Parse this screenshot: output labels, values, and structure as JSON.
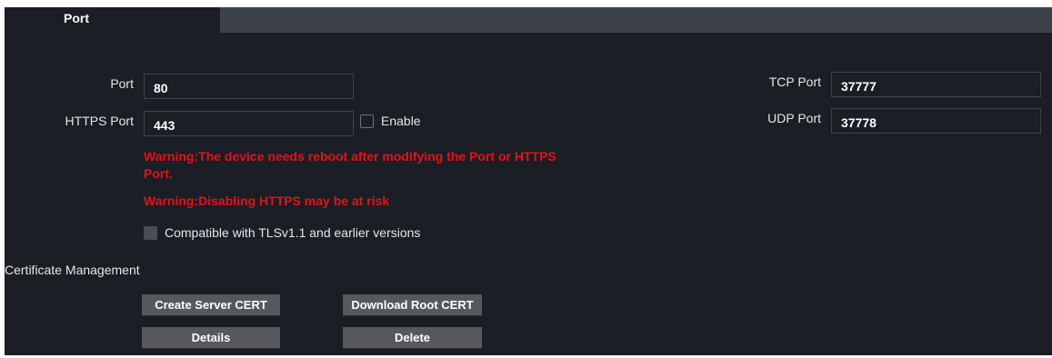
{
  "tab": {
    "label": "Port"
  },
  "port": {
    "label": "Port",
    "value": "80"
  },
  "https_port": {
    "label": "HTTPS Port",
    "value": "443",
    "enable_label": "Enable"
  },
  "tcp_port": {
    "label": "TCP Port",
    "value": "37777"
  },
  "udp_port": {
    "label": "UDP Port",
    "value": "37778"
  },
  "warnings": {
    "reboot_line1": "Warning:The device needs reboot after modifying the Port or HTTPS",
    "reboot_line2": "Port.",
    "https_risk": "Warning:Disabling HTTPS may be at risk"
  },
  "tls_compat_label": "Compatible with TLSv1.1 and earlier versions",
  "certificate": {
    "heading": "Certificate Management",
    "create_label": "Create Server CERT",
    "download_label": "Download Root CERT",
    "details_label": "Details",
    "delete_label": "Delete"
  },
  "colors": {
    "background": "#1b1e24",
    "warning": "#e3121b",
    "button": "#56585e"
  }
}
